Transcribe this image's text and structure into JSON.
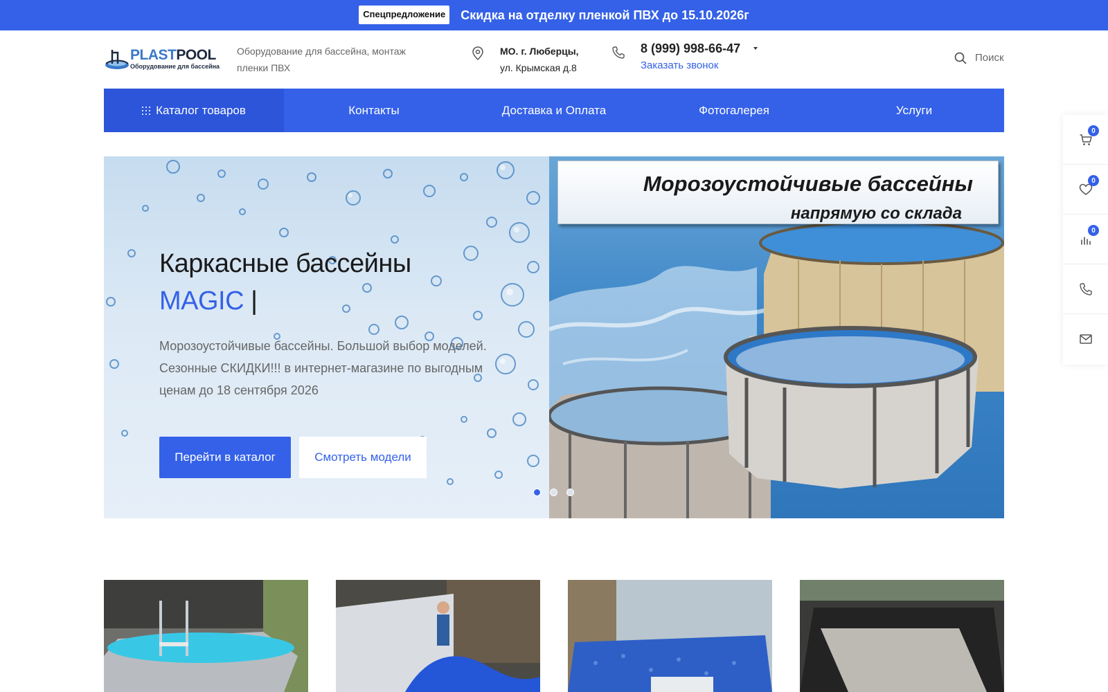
{
  "promo": {
    "badge": "Спецпредложение",
    "text": "Скидка на отделку пленкой ПВХ до 15.10.2026г"
  },
  "header": {
    "logo_part1": "PLAST",
    "logo_part2": "POOL",
    "logo_sub": "Оборудование для бассейна",
    "tagline": "Оборудование для бассейна, монтаж пленки ПВХ",
    "address_line1": "МО. г. Люберцы,",
    "address_line2": "ул. Крымская д.8",
    "phone": "8 (999) 998-66-47",
    "callback": "Заказать звонок",
    "search": "Поиск"
  },
  "nav": {
    "items": [
      {
        "label": "Каталог товаров"
      },
      {
        "label": "Контакты"
      },
      {
        "label": "Доставка и Оплата"
      },
      {
        "label": "Фотогалерея"
      },
      {
        "label": "Услуги"
      }
    ]
  },
  "hero": {
    "title": "Каркасные бассейны",
    "accent": "MAGIC",
    "cursor": "|",
    "description": "Морозоустойчивые бассейны. Большой выбор моделей. Сезонные СКИДКИ!!! в интернет-магазине по выгодным ценам до 18 сентября 2026",
    "btn_catalog": "Перейти в каталог",
    "btn_models": "Смотреть модели",
    "banner_line1": "Морозоустойчивые бассейны",
    "banner_line2": "напрямую со склада",
    "slide_count": 3,
    "active_slide": 1
  },
  "side": {
    "cart_count": "0",
    "favorites_count": "0",
    "compare_count": "0"
  },
  "colors": {
    "primary": "#3461e8",
    "text": "#222222",
    "muted": "#666666"
  }
}
